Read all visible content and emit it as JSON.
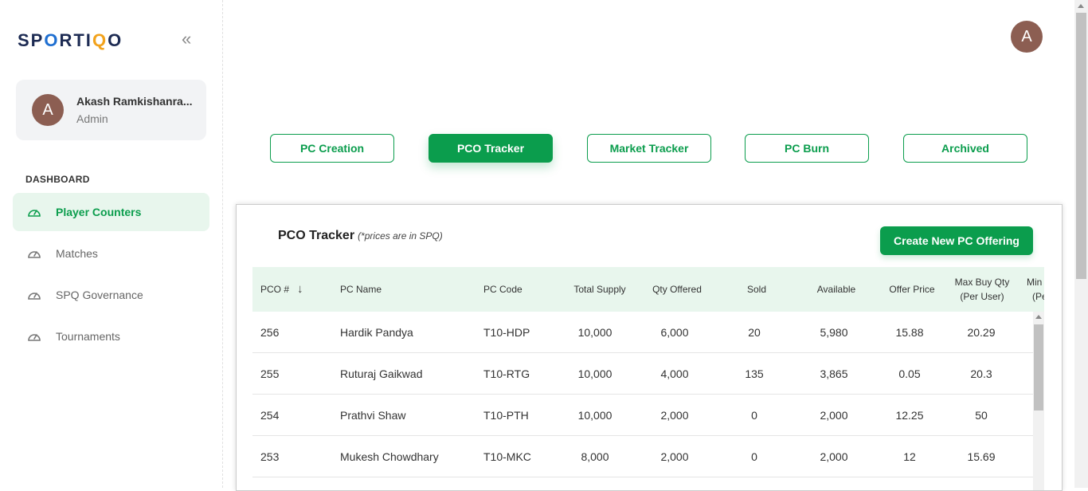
{
  "brand": {
    "logo_parts": [
      "SP",
      "O",
      "RTI",
      "Q",
      "O"
    ]
  },
  "sidebar": {
    "user": {
      "initial": "A",
      "name": "Akash Ramkishanra...",
      "role": "Admin"
    },
    "section": "DASHBOARD",
    "items": [
      {
        "label": "Player Counters",
        "icon": "gauge-icon",
        "active": true
      },
      {
        "label": "Matches",
        "icon": "gauge-icon",
        "active": false
      },
      {
        "label": "SPQ Governance",
        "icon": "gauge-icon",
        "active": false
      },
      {
        "label": "Tournaments",
        "icon": "gauge-icon",
        "active": false
      }
    ]
  },
  "header": {
    "avatar_initial": "A"
  },
  "tabs": [
    {
      "label": "PC Creation",
      "active": false
    },
    {
      "label": "PCO Tracker",
      "active": true
    },
    {
      "label": "Market Tracker",
      "active": false
    },
    {
      "label": "PC Burn",
      "active": false
    },
    {
      "label": "Archived",
      "active": false
    }
  ],
  "panel": {
    "title": "PCO Tracker",
    "note": "(*prices are in SPQ)",
    "create_button": "Create New PC Offering"
  },
  "table": {
    "columns": [
      "PCO #",
      "PC Name",
      "PC Code",
      "Total Supply",
      "Qty Offered",
      "Sold",
      "Available",
      "Offer Price",
      "Max Buy Qty",
      "(Per User)",
      "Min",
      "(Pe"
    ],
    "rows": [
      [
        "256",
        "Hardik Pandya",
        "T10-HDP",
        "10,000",
        "6,000",
        "20",
        "5,980",
        "15.88",
        "20.29"
      ],
      [
        "255",
        "Ruturaj Gaikwad",
        "T10-RTG",
        "10,000",
        "4,000",
        "135",
        "3,865",
        "0.05",
        "20.3"
      ],
      [
        "254",
        "Prathvi Shaw",
        "T10-PTH",
        "10,000",
        "2,000",
        "0",
        "2,000",
        "12.25",
        "50"
      ],
      [
        "253",
        "Mukesh Chowdhary",
        "T10-MKC",
        "8,000",
        "2,000",
        "0",
        "2,000",
        "12",
        "15.69"
      ]
    ]
  },
  "colors": {
    "accent": "#0b9d4d",
    "accent_light": "#e8f6ed",
    "avatar": "#8c5e52"
  }
}
